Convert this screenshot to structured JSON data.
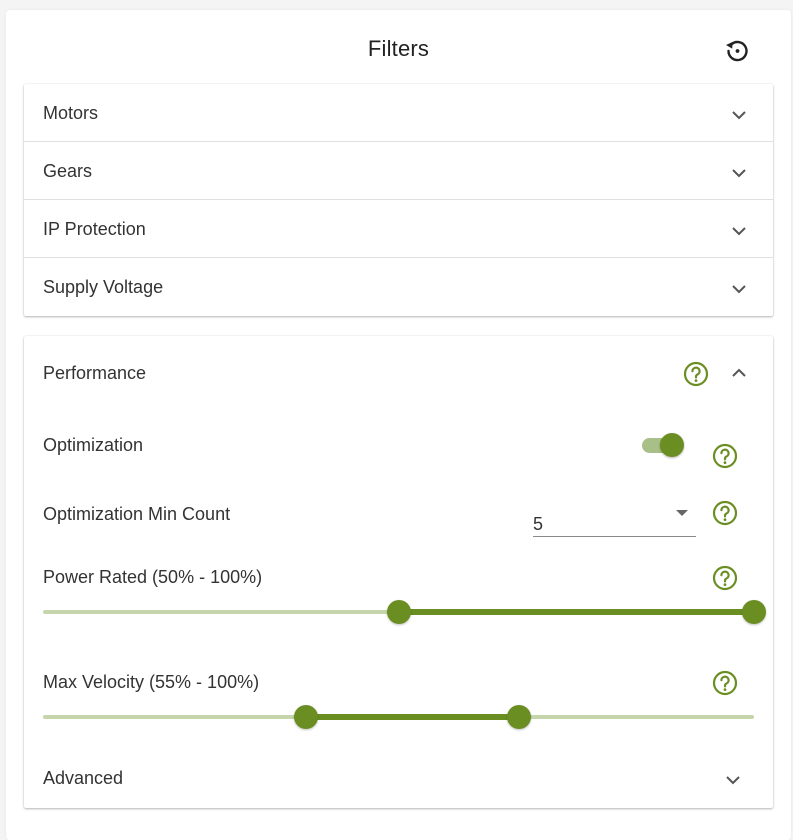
{
  "header": {
    "title": "Filters",
    "reset_icon": "restore-icon"
  },
  "sections": [
    {
      "label": "Motors",
      "expanded": false
    },
    {
      "label": "Gears",
      "expanded": false
    },
    {
      "label": "IP Protection",
      "expanded": false
    },
    {
      "label": "Supply Voltage",
      "expanded": false
    }
  ],
  "performance": {
    "title": "Performance",
    "expanded": true,
    "optimization": {
      "label": "Optimization",
      "enabled": true
    },
    "optimization_min_count": {
      "label": "Optimization Min Count",
      "value": "5"
    },
    "power_rated": {
      "label": "Power Rated (50% - 100%)",
      "min_percent": 50,
      "max_percent": 100
    },
    "max_velocity": {
      "label": "Max Velocity (55% - 100%)",
      "low_percent": 37,
      "high_percent": 67
    },
    "advanced": {
      "label": "Advanced",
      "expanded": false
    }
  },
  "colors": {
    "accent": "#6b8e23",
    "accent_light": "#c5d6ac",
    "text": "#333333"
  }
}
